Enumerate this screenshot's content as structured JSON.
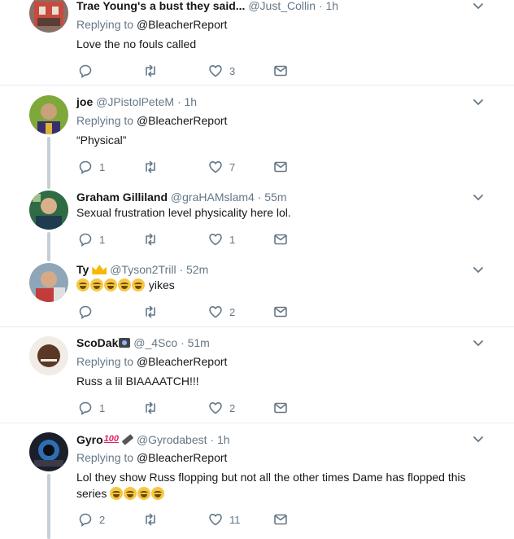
{
  "colors": {
    "accent": "#1da1f2",
    "meta": "#657786",
    "text": "#14171a",
    "divider": "#e6ecf0",
    "thread": "#c4cfd6"
  },
  "tweets": [
    {
      "name": "Trae Young's a bust they said...",
      "handle": "@Just_Collin",
      "time": "· 1h",
      "replying_prefix": "Replying to",
      "replying_handle": "@BleacherReport",
      "text": "Love the no fouls called",
      "reply_count": "",
      "retweet_count": "",
      "like_count": "3"
    },
    {
      "name": "joe",
      "handle": "@JPistolPeteM",
      "time": "· 1h",
      "replying_prefix": "Replying to",
      "replying_handle": "@BleacherReport",
      "text": "“Physical”",
      "reply_count": "1",
      "retweet_count": "",
      "like_count": "7"
    },
    {
      "name": "Graham Gilliland",
      "handle": "@graHAMslam4",
      "time": "· 55m",
      "text": "Sexual frustration level physicality here lol.",
      "reply_count": "1",
      "retweet_count": "",
      "like_count": "1"
    },
    {
      "name": "Ty",
      "handle": "@Tyson2Trill",
      "time": "· 52m",
      "text": "yikes",
      "reply_count": "",
      "retweet_count": "",
      "like_count": "2"
    },
    {
      "name": "ScoDak",
      "handle": "@_4Sco",
      "time": "· 51m",
      "replying_prefix": "Replying to",
      "replying_handle": "@BleacherReport",
      "text": "Russ a lil BIAAAATCH!!!",
      "reply_count": "1",
      "retweet_count": "",
      "like_count": "2"
    },
    {
      "name": "Gyro",
      "handle": "@Gyrodabest",
      "time": "· 1h",
      "replying_prefix": "Replying to",
      "replying_handle": "@BleacherReport",
      "text_line1": "Lol they show Russ flopping but not all the other times Dame has flopped this",
      "text_line2": "series",
      "reply_count": "2",
      "retweet_count": "",
      "like_count": "11"
    }
  ]
}
